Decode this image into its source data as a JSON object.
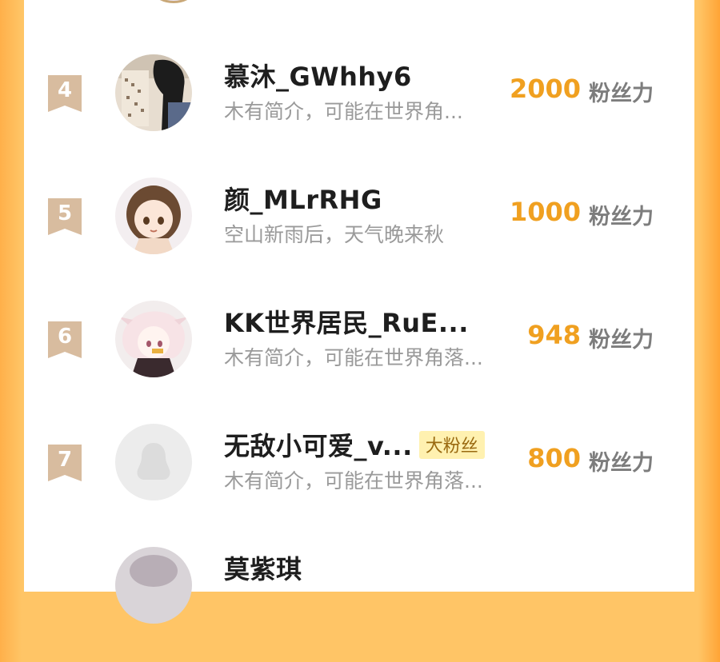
{
  "colors": {
    "accent_orange": "#f0a020",
    "rank_ribbon": "#d8bc9f",
    "background_orange": "#ffc566",
    "badge_yellow": "#fff1b0"
  },
  "ranking": [
    {
      "rank": "4",
      "name": "慕沐_GWhhy6",
      "bio": "木有简介，可能在世界角...",
      "score": "2000",
      "unit": "粉丝力",
      "avatar_icon": "photo-avatar-icon"
    },
    {
      "rank": "5",
      "name": "颜_MLrRHG",
      "bio": "空山新雨后，天气晚来秋",
      "score": "1000",
      "unit": "粉丝力",
      "avatar_icon": "anime-girl-avatar-icon"
    },
    {
      "rank": "6",
      "name": "KK世界居民_RuE...",
      "bio": "木有简介，可能在世界角落...",
      "score": "948",
      "unit": "粉丝力",
      "avatar_icon": "anime-character-avatar-icon"
    },
    {
      "rank": "7",
      "name": "无敌小可爱_v...",
      "badge": "大粉丝",
      "bio": "木有简介，可能在世界角落...",
      "score": "800",
      "unit": "粉丝力",
      "avatar_icon": "default-penguin-avatar-icon"
    },
    {
      "rank": "",
      "name": "莫紫琪",
      "bio": "",
      "score": "",
      "unit": "",
      "avatar_icon": "photo-avatar-icon"
    }
  ]
}
